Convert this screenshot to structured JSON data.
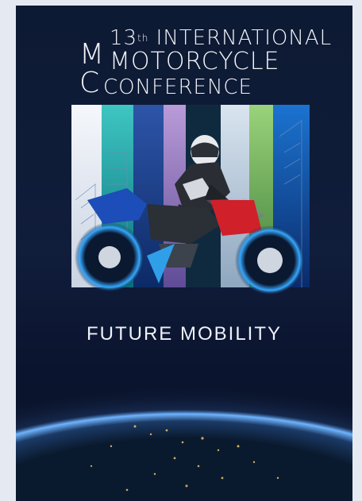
{
  "poster": {
    "title": {
      "ordinal": "13",
      "ordinal_suffix": "th",
      "line1_rest": "INTERNATIONAL",
      "line2": "MOTORCYCLE",
      "line3": "CONFERENCE",
      "big_letter_line2": "M",
      "big_letter_line3": "C"
    },
    "tagline": "FUTURE MOBILITY"
  },
  "colors": {
    "background": "#101d3b",
    "accent_blue": "#2fa3ff",
    "accent_red": "#d0202a",
    "text": "#f2f4f8"
  }
}
